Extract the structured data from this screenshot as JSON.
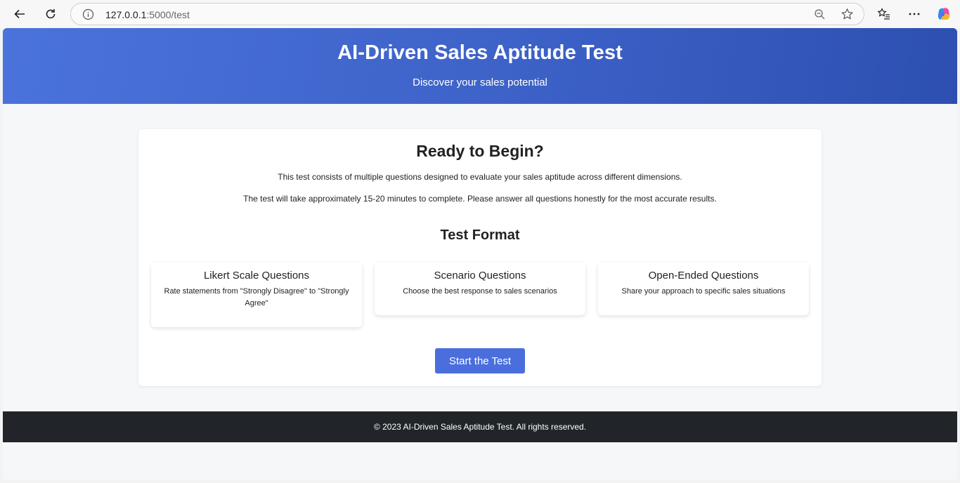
{
  "browser": {
    "url_host": "127.0.0.1",
    "url_path": ":5000/test"
  },
  "header": {
    "title": "AI-Driven Sales Aptitude Test",
    "subtitle": "Discover your sales potential"
  },
  "intro": {
    "heading": "Ready to Begin?",
    "paragraph1": "This test consists of multiple questions designed to evaluate your sales aptitude across different dimensions.",
    "paragraph2": "The test will take approximately 15-20 minutes to complete. Please answer all questions honestly for the most accurate results."
  },
  "format": {
    "heading": "Test Format",
    "items": [
      {
        "title": "Likert Scale Questions",
        "desc": "Rate statements from \"Strongly Disagree\" to \"Strongly Agree\""
      },
      {
        "title": "Scenario Questions",
        "desc": "Choose the best response to sales scenarios"
      },
      {
        "title": "Open-Ended Questions",
        "desc": "Share your approach to specific sales situations"
      }
    ]
  },
  "start_button": "Start the Test",
  "footer": "© 2023 AI-Driven Sales Aptitude Test. All rights reserved.",
  "colors": {
    "header_start": "#4a73db",
    "header_end": "#2d4fb2",
    "button": "#4a6fdc",
    "footer_bg": "#212529"
  }
}
